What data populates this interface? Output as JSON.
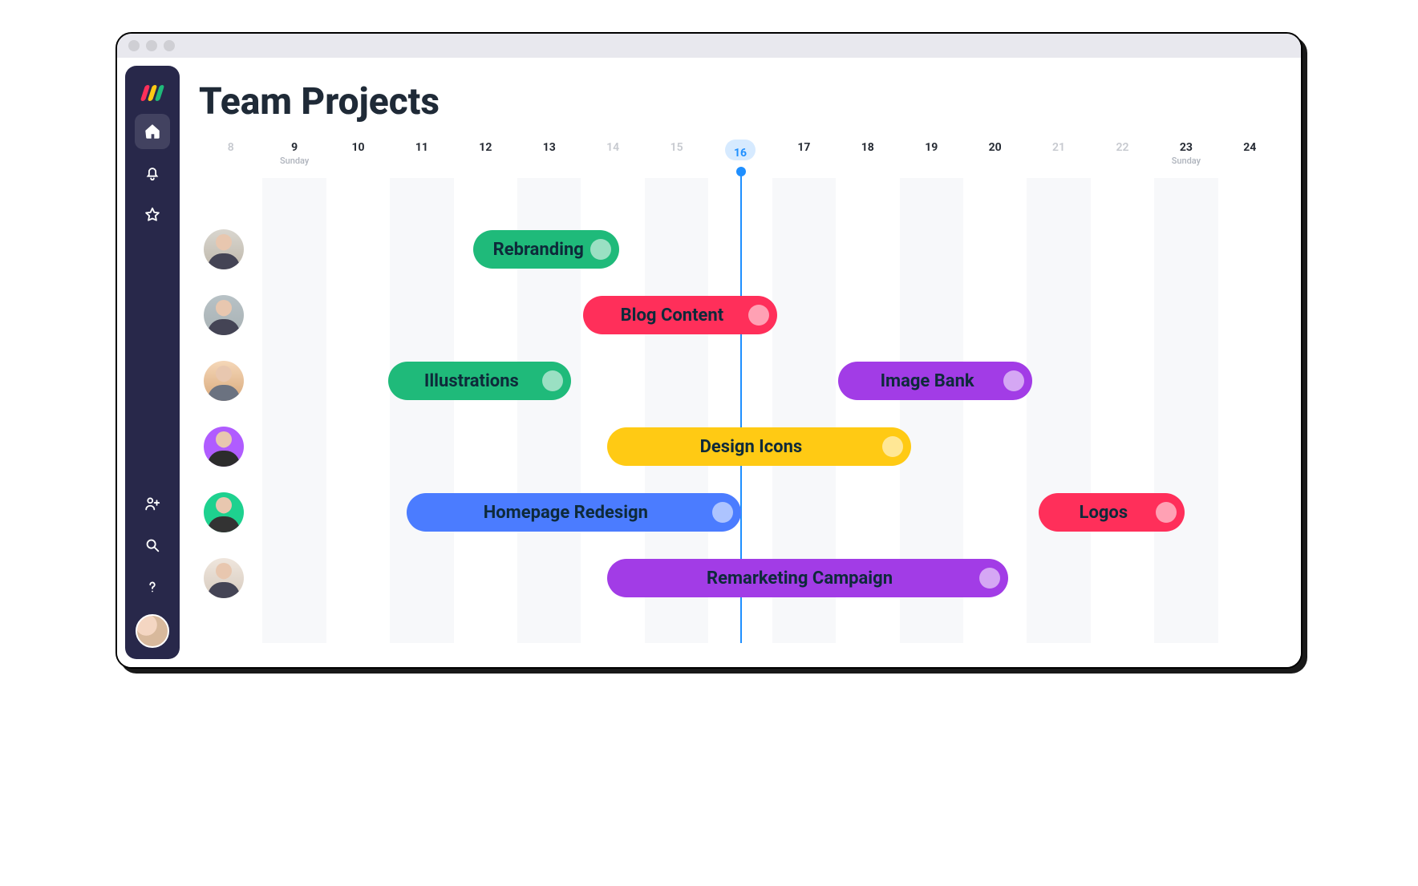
{
  "page": {
    "title": "Team Projects"
  },
  "sidebar": {
    "items": [
      {
        "name": "home",
        "icon": "home-icon"
      },
      {
        "name": "notifications",
        "icon": "bell-icon"
      },
      {
        "name": "favorites",
        "icon": "star-icon"
      },
      {
        "name": "invite",
        "icon": "add-user-icon"
      },
      {
        "name": "search",
        "icon": "search-icon"
      },
      {
        "name": "help",
        "icon": "help-icon"
      }
    ]
  },
  "dates": [
    {
      "d": "8",
      "dow": "",
      "muted": true,
      "shade": false,
      "today": false
    },
    {
      "d": "9",
      "dow": "Sunday",
      "muted": false,
      "shade": true,
      "today": false
    },
    {
      "d": "10",
      "dow": "",
      "muted": false,
      "shade": false,
      "today": false
    },
    {
      "d": "11",
      "dow": "",
      "muted": false,
      "shade": true,
      "today": false
    },
    {
      "d": "12",
      "dow": "",
      "muted": false,
      "shade": false,
      "today": false
    },
    {
      "d": "13",
      "dow": "",
      "muted": false,
      "shade": true,
      "today": false
    },
    {
      "d": "14",
      "dow": "",
      "muted": true,
      "shade": false,
      "today": false
    },
    {
      "d": "15",
      "dow": "",
      "muted": true,
      "shade": true,
      "today": false
    },
    {
      "d": "16",
      "dow": "",
      "muted": false,
      "shade": false,
      "today": true
    },
    {
      "d": "17",
      "dow": "",
      "muted": false,
      "shade": true,
      "today": false
    },
    {
      "d": "18",
      "dow": "",
      "muted": false,
      "shade": false,
      "today": false
    },
    {
      "d": "19",
      "dow": "",
      "muted": false,
      "shade": true,
      "today": false
    },
    {
      "d": "20",
      "dow": "",
      "muted": false,
      "shade": false,
      "today": false
    },
    {
      "d": "21",
      "dow": "",
      "muted": true,
      "shade": true,
      "today": false
    },
    {
      "d": "22",
      "dow": "",
      "muted": true,
      "shade": false,
      "today": false
    },
    {
      "d": "23",
      "dow": "Sunday",
      "muted": false,
      "shade": true,
      "today": false
    },
    {
      "d": "24",
      "dow": "",
      "muted": false,
      "shade": false,
      "today": false
    }
  ],
  "today_index": 8,
  "colors": {
    "green": "#1fba7a",
    "red": "#ff2f5a",
    "purple": "#a23ce6",
    "yellow": "#ffca14",
    "blue": "#4b7cff"
  },
  "rows": [
    {
      "avatar": "av1",
      "bars": [
        {
          "label": "Rebranding",
          "start": 3.7,
          "end": 6.1,
          "color": "green"
        }
      ]
    },
    {
      "avatar": "av2",
      "bars": [
        {
          "label": "Blog Content",
          "start": 5.5,
          "end": 8.7,
          "color": "red"
        }
      ]
    },
    {
      "avatar": "av3",
      "bars": [
        {
          "label": "Illustrations",
          "start": 2.3,
          "end": 5.3,
          "color": "green"
        },
        {
          "label": "Image Bank",
          "start": 9.7,
          "end": 12.9,
          "color": "purple"
        }
      ]
    },
    {
      "avatar": "av4",
      "bars": [
        {
          "label": "Design Icons",
          "start": 5.9,
          "end": 10.9,
          "color": "yellow"
        }
      ]
    },
    {
      "avatar": "av5",
      "bars": [
        {
          "label": "Homepage Redesign",
          "start": 2.6,
          "end": 8.1,
          "color": "blue"
        },
        {
          "label": "Logos",
          "start": 13.0,
          "end": 15.4,
          "color": "red"
        }
      ]
    },
    {
      "avatar": "av6",
      "bars": [
        {
          "label": "Remarketing Campaign",
          "start": 5.9,
          "end": 12.5,
          "color": "purple"
        }
      ]
    }
  ]
}
